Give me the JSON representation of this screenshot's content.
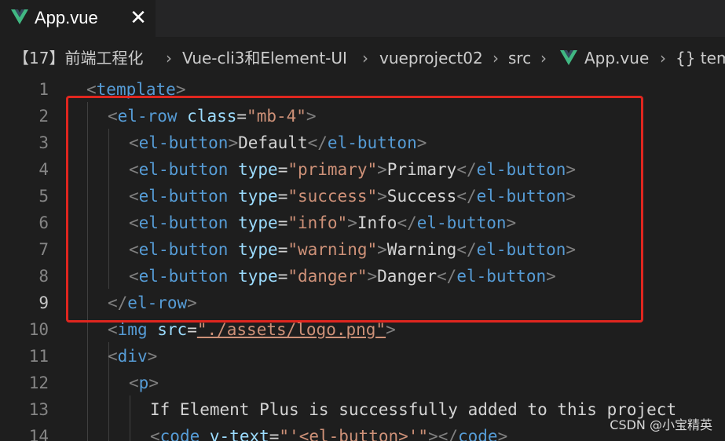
{
  "tab": {
    "title": "App.vue",
    "icon": "vue-icon",
    "close_icon": "close-icon",
    "close_glyph": "✕",
    "accent": "#41b883"
  },
  "breadcrumb": {
    "items": [
      "【17】前端工程化",
      "Vue-cli3和Element-UI",
      "vueproject02",
      "src",
      "App.vue",
      "{} tem"
    ],
    "separator": "›"
  },
  "editor": {
    "active_line": "9",
    "lines": [
      {
        "num": "1",
        "tokens": [
          [
            "punct",
            "<"
          ],
          [
            "tag",
            "template"
          ],
          [
            "punct",
            ">"
          ]
        ]
      },
      {
        "num": "2",
        "tokens": [
          [
            "punct",
            "<"
          ],
          [
            "tag",
            "el-row"
          ],
          [
            "text",
            " "
          ],
          [
            "attr",
            "class"
          ],
          [
            "text",
            "="
          ],
          [
            "str",
            "\"mb-4\""
          ],
          [
            "punct",
            ">"
          ]
        ]
      },
      {
        "num": "3",
        "tokens": [
          [
            "punct",
            "<"
          ],
          [
            "tag",
            "el-button"
          ],
          [
            "punct",
            ">"
          ],
          [
            "text",
            "Default"
          ],
          [
            "punct",
            "</"
          ],
          [
            "tag",
            "el-button"
          ],
          [
            "punct",
            ">"
          ]
        ]
      },
      {
        "num": "4",
        "tokens": [
          [
            "punct",
            "<"
          ],
          [
            "tag",
            "el-button"
          ],
          [
            "text",
            " "
          ],
          [
            "attr",
            "type"
          ],
          [
            "text",
            "="
          ],
          [
            "str",
            "\"primary\""
          ],
          [
            "punct",
            ">"
          ],
          [
            "text",
            "Primary"
          ],
          [
            "punct",
            "</"
          ],
          [
            "tag",
            "el-button"
          ],
          [
            "punct",
            ">"
          ]
        ]
      },
      {
        "num": "5",
        "tokens": [
          [
            "punct",
            "<"
          ],
          [
            "tag",
            "el-button"
          ],
          [
            "text",
            " "
          ],
          [
            "attr",
            "type"
          ],
          [
            "text",
            "="
          ],
          [
            "str",
            "\"success\""
          ],
          [
            "punct",
            ">"
          ],
          [
            "text",
            "Success"
          ],
          [
            "punct",
            "</"
          ],
          [
            "tag",
            "el-button"
          ],
          [
            "punct",
            ">"
          ]
        ]
      },
      {
        "num": "6",
        "tokens": [
          [
            "punct",
            "<"
          ],
          [
            "tag",
            "el-button"
          ],
          [
            "text",
            " "
          ],
          [
            "attr",
            "type"
          ],
          [
            "text",
            "="
          ],
          [
            "str",
            "\"info\""
          ],
          [
            "punct",
            ">"
          ],
          [
            "text",
            "Info"
          ],
          [
            "punct",
            "</"
          ],
          [
            "tag",
            "el-button"
          ],
          [
            "punct",
            ">"
          ]
        ]
      },
      {
        "num": "7",
        "tokens": [
          [
            "punct",
            "<"
          ],
          [
            "tag",
            "el-button"
          ],
          [
            "text",
            " "
          ],
          [
            "attr",
            "type"
          ],
          [
            "text",
            "="
          ],
          [
            "str",
            "\"warning\""
          ],
          [
            "punct",
            ">"
          ],
          [
            "text",
            "Warning"
          ],
          [
            "punct",
            "</"
          ],
          [
            "tag",
            "el-button"
          ],
          [
            "punct",
            ">"
          ]
        ]
      },
      {
        "num": "8",
        "tokens": [
          [
            "punct",
            "<"
          ],
          [
            "tag",
            "el-button"
          ],
          [
            "text",
            " "
          ],
          [
            "attr",
            "type"
          ],
          [
            "text",
            "="
          ],
          [
            "str",
            "\"danger\""
          ],
          [
            "punct",
            ">"
          ],
          [
            "text",
            "Danger"
          ],
          [
            "punct",
            "</"
          ],
          [
            "tag",
            "el-button"
          ],
          [
            "punct",
            ">"
          ]
        ]
      },
      {
        "num": "9",
        "tokens": [
          [
            "punct",
            "</"
          ],
          [
            "tag",
            "el-row"
          ],
          [
            "punct",
            ">"
          ]
        ]
      },
      {
        "num": "10",
        "tokens": [
          [
            "punct",
            "<"
          ],
          [
            "tag",
            "img"
          ],
          [
            "text",
            " "
          ],
          [
            "attr",
            "src"
          ],
          [
            "text",
            "="
          ],
          [
            "str",
            "\"./assets/logo.png\""
          ],
          [
            "punct",
            ">"
          ]
        ]
      },
      {
        "num": "11",
        "tokens": [
          [
            "punct",
            "<"
          ],
          [
            "tag",
            "div"
          ],
          [
            "punct",
            ">"
          ]
        ]
      },
      {
        "num": "12",
        "tokens": [
          [
            "punct",
            "<"
          ],
          [
            "tag",
            "p"
          ],
          [
            "punct",
            ">"
          ]
        ]
      },
      {
        "num": "13",
        "tokens": [
          [
            "text",
            "If Element Plus is successfully added to this project"
          ]
        ]
      },
      {
        "num": "14",
        "tokens": [
          [
            "punct",
            "<"
          ],
          [
            "tag",
            "code"
          ],
          [
            "text",
            " "
          ],
          [
            "attr",
            "v-text"
          ],
          [
            "text",
            "="
          ],
          [
            "str",
            "\"'<el-button>'\""
          ],
          [
            "punct",
            "></"
          ],
          [
            "tag",
            "code"
          ],
          [
            "punct",
            ">"
          ]
        ]
      }
    ]
  },
  "watermark": "CSDN @小宝精英",
  "colors": {
    "background": "#1e1e1e",
    "tab_bar": "#252526",
    "tag": "#569cd6",
    "attr": "#9cdcfe",
    "string": "#ce9178",
    "text": "#d4d4d4",
    "punct": "#808080",
    "highlight_box": "#e0261f"
  }
}
